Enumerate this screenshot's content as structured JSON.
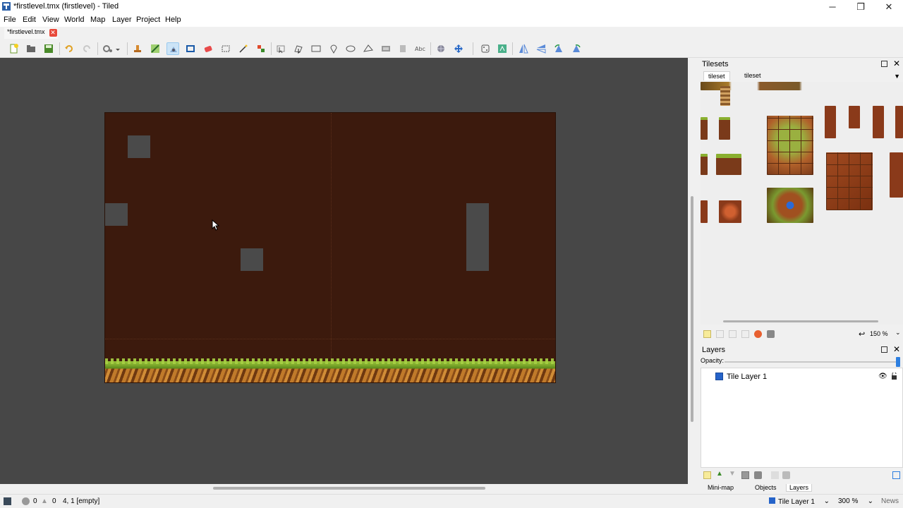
{
  "window": {
    "title": "*firstlevel.tmx (firstlevel) - Tiled",
    "minimize": "─",
    "maximize": "❐",
    "close": "✕"
  },
  "menu": [
    "File",
    "Edit",
    "View",
    "World",
    "Map",
    "Layer",
    "Project",
    "Help"
  ],
  "document_tab": {
    "label": "*firstlevel.tmx",
    "close": "✕"
  },
  "tilesets_panel": {
    "title": "Tilesets",
    "tabs": [
      "tileset",
      "tileset"
    ],
    "zoom": "150 %"
  },
  "layers_panel": {
    "title": "Layers",
    "opacity_label": "Opacity:",
    "opacity": 1.0,
    "layers": [
      {
        "name": "Tile Layer 1",
        "visible": true
      }
    ]
  },
  "bottom_tabs": [
    "Mini-map",
    "Objects",
    "Layers"
  ],
  "status": {
    "errors": "0",
    "warnings": "0",
    "coords": "4, 1 [empty]",
    "current_layer": "Tile Layer 1",
    "zoom": "300 %",
    "news": "News"
  },
  "colors": {
    "map_background": "#3c1a0d",
    "canvas": "#474747",
    "accent": "#2d7fe0"
  }
}
